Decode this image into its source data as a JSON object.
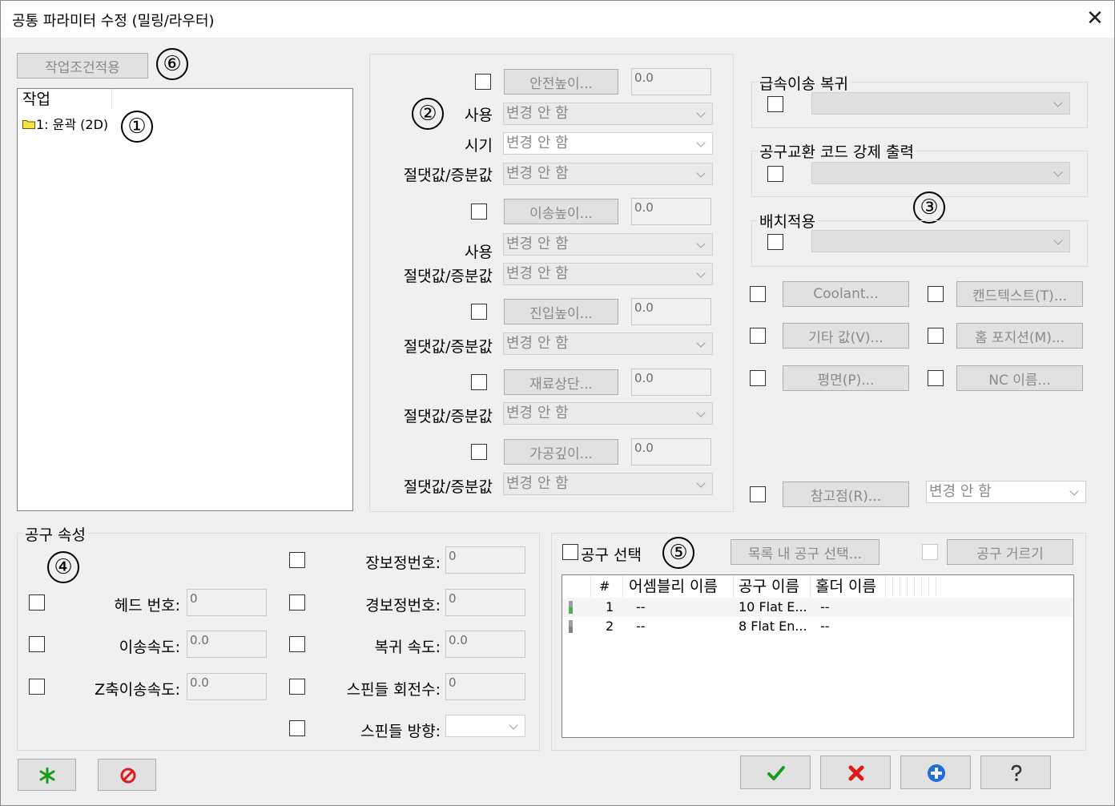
{
  "window": {
    "title": "공통 파라미터 수정 (밀링/라우터)",
    "close_glyph": "✕"
  },
  "apply_btn": "작업조건적용",
  "tree": {
    "header": "작업",
    "items": [
      {
        "label": "1: 윤곽 (2D)"
      }
    ]
  },
  "markers": [
    "①",
    "②",
    "③",
    "④",
    "⑤",
    "⑥"
  ],
  "heights": {
    "safety": {
      "btn": "안전높이...",
      "value": "0.0",
      "use_label": "사용",
      "use_value": "변경 안 함",
      "when_label": "시기",
      "when_value": "변경 안 함",
      "abs_label": "절댓값/증분값",
      "abs_value": "변경 안 함"
    },
    "retract": {
      "btn": "이송높이...",
      "value": "0.0",
      "use_label": "사용",
      "use_value": "변경 안 함",
      "abs_label": "절댓값/증분값",
      "abs_value": "변경 안 함"
    },
    "feed": {
      "btn": "진입높이...",
      "value": "0.0",
      "abs_label": "절댓값/증분값",
      "abs_value": "변경 안 함"
    },
    "top": {
      "btn": "재료상단...",
      "value": "0.0",
      "abs_label": "절댓값/증분값",
      "abs_value": "변경 안 함"
    },
    "depth": {
      "btn": "가공깊이...",
      "value": "0.0",
      "abs_label": "절댓값/증분값",
      "abs_value": "변경 안 함"
    }
  },
  "right": {
    "rapid_return": "급속이송 복귀",
    "force_tool_change": "공구교환 코드 강제 출력",
    "batch_apply": "배치적용",
    "buttons": {
      "coolant": "Coolant...",
      "canned": "캔드텍스트(T)...",
      "misc": "기타 값(V)...",
      "home": "홈 포지션(M)...",
      "plane": "평면(P)...",
      "nc_name": "NC 이름..."
    },
    "ref_btn": "참고점(R)...",
    "ref_value": "변경 안 함"
  },
  "tool_props": {
    "title": "공구 속성",
    "head": {
      "label": "헤드 번호:",
      "value": "0"
    },
    "feed": {
      "label": "이송속도:",
      "value": "0.0"
    },
    "plunge": {
      "label": "Z축이송속도:",
      "value": "0.0"
    },
    "length_offset": {
      "label": "장보정번호:",
      "value": "0"
    },
    "diam_offset": {
      "label": "경보정번호:",
      "value": "0"
    },
    "retract_rate": {
      "label": "복귀 속도:",
      "value": "0.0"
    },
    "spindle_speed": {
      "label": "스핀들 회전수:",
      "value": "0"
    },
    "spindle_dir": {
      "label": "스핀들 방향:",
      "value": ""
    }
  },
  "tool_select": {
    "label": "공구 선택",
    "list_btn": "목록 내 공구 선택...",
    "filter_btn": "공구 거르기",
    "columns": [
      "#",
      "어셈블리 이름",
      "공구 이름",
      "홀더 이름"
    ],
    "rows": [
      {
        "num": "1",
        "assembly": "--",
        "tool": "10 Flat E...",
        "holder": "--"
      },
      {
        "num": "2",
        "assembly": "--",
        "tool": "8 Flat En...",
        "holder": "--"
      }
    ]
  },
  "colors": {
    "green": "#1a9a1a",
    "red": "#e01a1a",
    "blue": "#1e6fd9"
  }
}
